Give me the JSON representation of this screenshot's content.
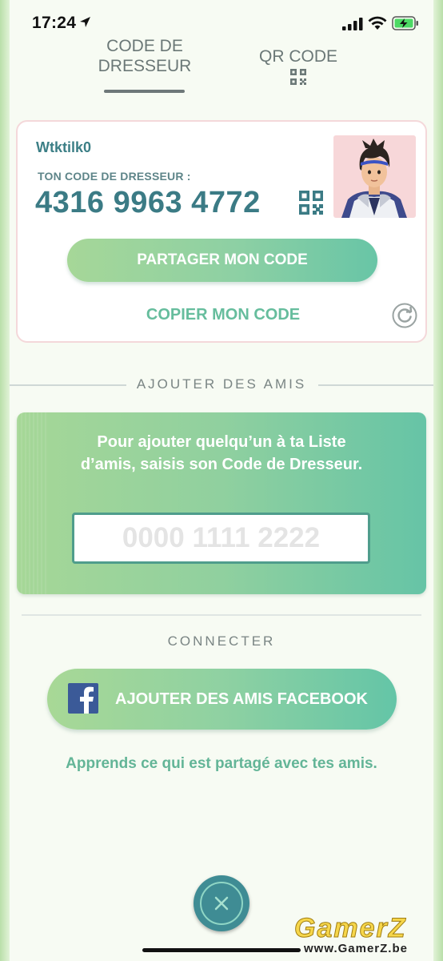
{
  "status_bar": {
    "time": "17:24",
    "icons": [
      "location-arrow-icon",
      "signal-icon",
      "wifi-icon",
      "battery-charging-icon"
    ]
  },
  "tabs": [
    {
      "label_line1": "CODE DE",
      "label_line2": "DRESSEUR",
      "active": true
    },
    {
      "label": "QR CODE",
      "icon": "qr-code-icon",
      "active": false
    }
  ],
  "trainer_card": {
    "username": "Wtktilk0",
    "code_label": "TON CODE DE DRESSEUR :",
    "code": "4316 9963 4772",
    "share_button": "PARTAGER MON CODE",
    "copy_link": "COPIER MON CODE"
  },
  "add_friends": {
    "title": "AJOUTER DES AMIS",
    "instructions": "Pour ajouter quelqu’un à ta Liste d’amis, saisis son Code de Dresseur.",
    "input_placeholder": "0000 1111 2222",
    "input_value": ""
  },
  "connect": {
    "title": "CONNECTER",
    "facebook_button": "AJOUTER DES AMIS FACEBOOK",
    "learn_link": "Apprends ce qui est partagé avec tes amis."
  },
  "watermark": {
    "logo": "GamerZ",
    "url": "www.GamerZ.be"
  },
  "colors": {
    "accent_teal": "#3b7b85",
    "gradient_start": "#a6d798",
    "gradient_end": "#66c4a6",
    "facebook_blue": "#3b5a98"
  }
}
